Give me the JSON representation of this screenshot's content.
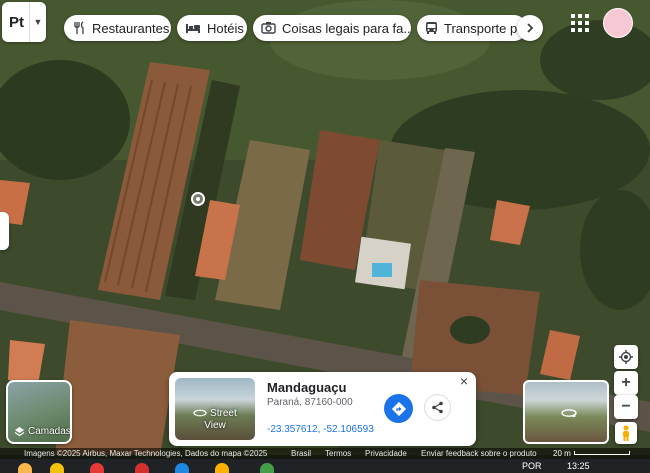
{
  "language_button": {
    "code": "Pt"
  },
  "category_chips": [
    {
      "label": "Restaurantes",
      "icon": "fork-knife-icon"
    },
    {
      "label": "Hotéis",
      "icon": "bed-icon"
    },
    {
      "label": "Coisas legais para fa...",
      "icon": "camera-icon"
    },
    {
      "label": "Transporte pú",
      "icon": "bus-icon"
    }
  ],
  "layers_button": {
    "label": "Camadas"
  },
  "place_card": {
    "street_view_label_1": "Street",
    "street_view_label_2": "View",
    "title": "Mandaguaçu",
    "address": "Paraná, 87160-000",
    "coordinates": "-23.357612, -52.106593",
    "close_symbol": "×"
  },
  "map_controls": {
    "zoom_in": "+",
    "zoom_out": "−"
  },
  "attribution": {
    "imagery": "Imagens ©2025 Airbus, Maxar Technologies, Dados do mapa ©2025",
    "country": "Brasil",
    "terms": "Termos",
    "privacy": "Privacidade",
    "feedback": "Enviar feedback sobre o produto",
    "scale": "20 m"
  },
  "taskbar": {
    "lang": "POR",
    "time": "13:25"
  },
  "colors": {
    "accent_blue": "#1a73e8",
    "avatar_pink": "#f6c8d4"
  }
}
